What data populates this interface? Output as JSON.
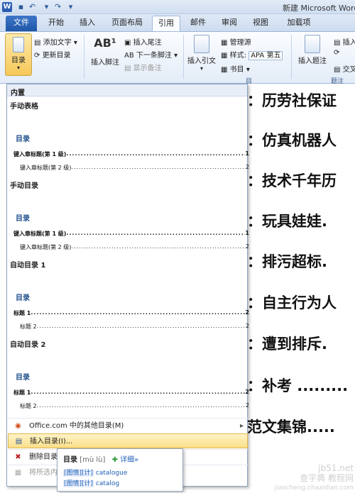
{
  "titlebar": {
    "app_icon": "W",
    "doc_title": "新建 Microsoft Word"
  },
  "tabs": [
    "文件",
    "开始",
    "插入",
    "页面布局",
    "引用",
    "邮件",
    "审阅",
    "视图",
    "加载项"
  ],
  "ribbon": {
    "toc_label": "目录",
    "add_text": "添加文字",
    "update_toc": "更新目录",
    "insert_footnote": "插入脚注",
    "insert_endnote": "插入尾注",
    "next_footnote": "下一条脚注",
    "show_notes": "显示备注",
    "insert_citation": "插入引文",
    "manage_sources": "管理源",
    "style_label": "样式:",
    "style_value": "APA 第五",
    "bibliography": "书目",
    "insert_caption": "插入题注",
    "insert_more": "插入",
    "cross_ref": "交叉",
    "group_caption": "题注",
    "group_cite_tail": "目"
  },
  "gallery": {
    "header": "内置",
    "manual_table": "手动表格",
    "manual_toc": "手动目录",
    "auto_toc1": "自动目录 1",
    "auto_toc2": "自动目录 2",
    "toc_word": "目录",
    "lvl1_text": "键入章标题(第 1 级)",
    "lvl2_text": "键入章标题(第 2 级)",
    "h1_text": "标题 1",
    "h2_text": "标题 2",
    "page1": "1",
    "page2": "2",
    "more_office": "Office.com 中的其他目录(M)",
    "insert_toc": "插入目录(I)...",
    "delete_toc": "删除目录",
    "save_sel": "将所选内"
  },
  "doc_lines": [
    "：历劳社保证",
    "：仿真机器人",
    "：技术千年历",
    "：玩具娃娃.",
    "：排污超标.",
    "：自主行为人",
    "：遭到排斥.",
    "：补考 .........",
    "范文集锦....."
  ],
  "popup": {
    "word": "目录",
    "pinyin": "[mù lù]",
    "detail": "详细»",
    "row1_tag": "[图情][计]",
    "row1_word": "catalogue",
    "row2_tag": "[图情][计]",
    "row2_word": "catalog"
  },
  "watermark": {
    "line1": "jb51.net",
    "line2": "查字典 教程网",
    "line3": "jiaocheng.chazidian.com"
  }
}
